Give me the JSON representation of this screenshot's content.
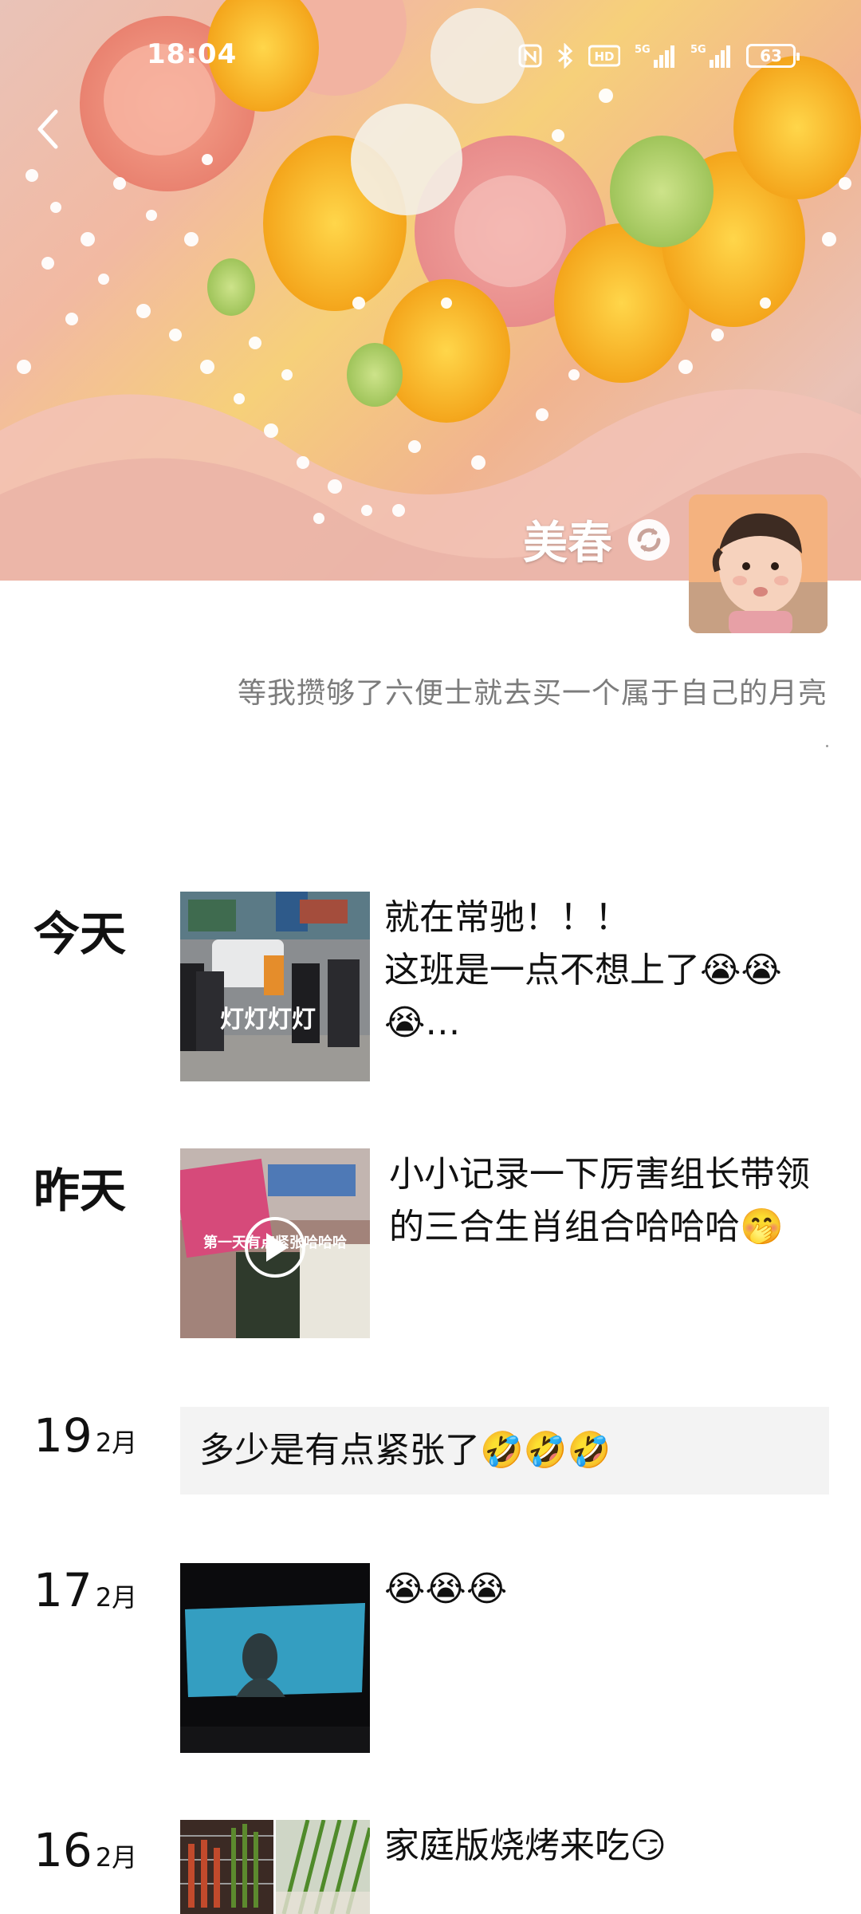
{
  "status_bar": {
    "time": "18:04",
    "battery": "63",
    "icons": [
      "nfc-icon",
      "bluetooth-icon",
      "hd-icon",
      "5g-signal-icon",
      "5g-signal-icon",
      "battery-icon"
    ]
  },
  "profile": {
    "name": "美春",
    "signature": "等我攒够了六便士就去买一个属于自己的月亮"
  },
  "feed": [
    {
      "date_label": "今天",
      "text_lines": [
        "就在常驰！！！",
        "这班是一点不想上了😭😭",
        "😭…"
      ],
      "thumb_caption": "灯灯灯灯"
    },
    {
      "date_label": "昨天",
      "text_lines": [
        "小小记录一下厉害组长带领",
        "的三合生肖组合哈哈哈🤭"
      ],
      "thumb_caption": "第一天有点紧张哈哈哈"
    },
    {
      "day": "19",
      "month": "2月",
      "text": "多少是有点紧张了🤣🤣🤣"
    },
    {
      "day": "17",
      "month": "2月",
      "text": "😭😭😭"
    },
    {
      "day": "16",
      "month": "2月",
      "text": "家庭版烧烤来吃😏"
    }
  ],
  "colors": {
    "text": "#111111",
    "muted": "#7c7c7c",
    "card_bg": "#f3f3f3"
  }
}
